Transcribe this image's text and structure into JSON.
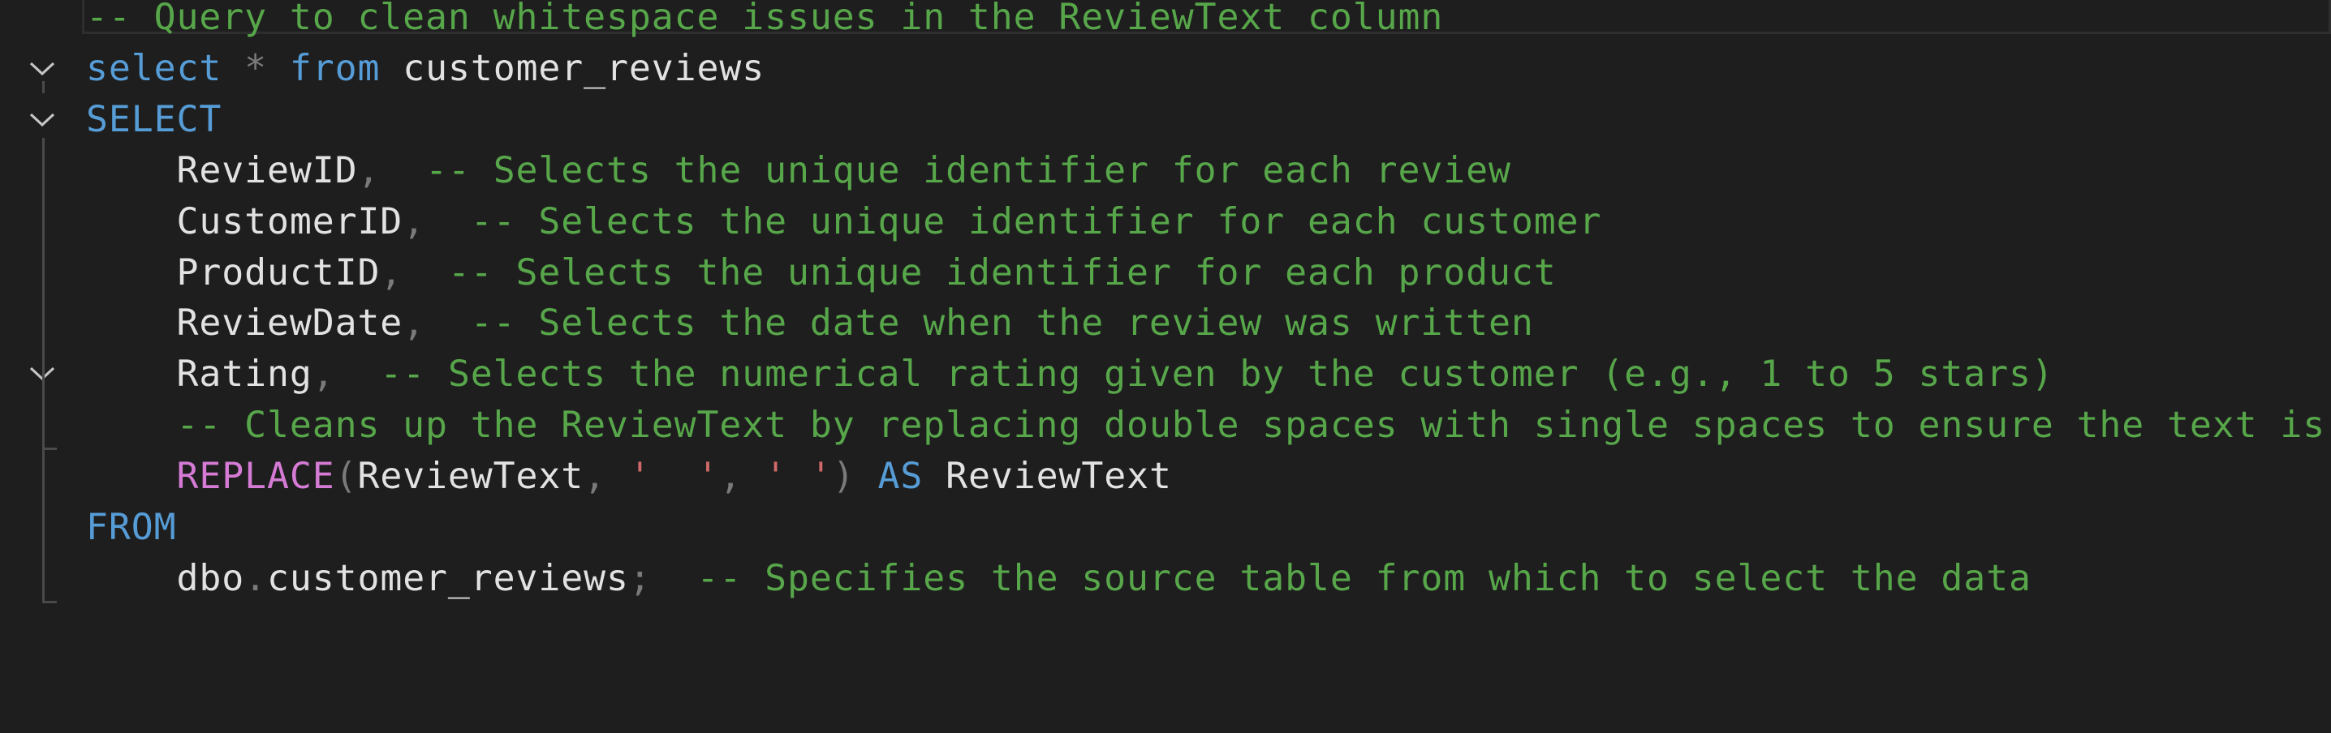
{
  "editor": {
    "language": "SQL",
    "fold_icon": "chevron-down-icon",
    "lines": [
      [
        {
          "t": "-- Query to clean whitespace issues in the ReviewText column",
          "c": "cm"
        }
      ],
      [
        {
          "t": "select",
          "c": "kw"
        },
        {
          "t": " ",
          "c": "id"
        },
        {
          "t": "*",
          "c": "pu"
        },
        {
          "t": " ",
          "c": "id"
        },
        {
          "t": "from",
          "c": "kw"
        },
        {
          "t": " customer_reviews",
          "c": "id"
        }
      ],
      [
        {
          "t": "SELECT",
          "c": "kw"
        }
      ],
      [
        {
          "t": "    ReviewID",
          "c": "id"
        },
        {
          "t": ",",
          "c": "pu"
        },
        {
          "t": "  ",
          "c": "id"
        },
        {
          "t": "-- Selects the unique identifier for each review",
          "c": "cm"
        }
      ],
      [
        {
          "t": "    CustomerID",
          "c": "id"
        },
        {
          "t": ",",
          "c": "pu"
        },
        {
          "t": "  ",
          "c": "id"
        },
        {
          "t": "-- Selects the unique identifier for each customer",
          "c": "cm"
        }
      ],
      [
        {
          "t": "    ProductID",
          "c": "id"
        },
        {
          "t": ",",
          "c": "pu"
        },
        {
          "t": "  ",
          "c": "id"
        },
        {
          "t": "-- Selects the unique identifier for each product",
          "c": "cm"
        }
      ],
      [
        {
          "t": "    ReviewDate",
          "c": "id"
        },
        {
          "t": ",",
          "c": "pu"
        },
        {
          "t": "  ",
          "c": "id"
        },
        {
          "t": "-- Selects the date when the review was written",
          "c": "cm"
        }
      ],
      [
        {
          "t": "    Rating",
          "c": "id"
        },
        {
          "t": ",",
          "c": "pu"
        },
        {
          "t": "  ",
          "c": "id"
        },
        {
          "t": "-- Selects the numerical rating given by the customer (e.g., 1 to 5 stars)",
          "c": "cm"
        }
      ],
      [
        {
          "t": "    ",
          "c": "id"
        },
        {
          "t": "-- Cleans up the ReviewText by replacing double spaces with single spaces to ensure the text is",
          "c": "cm"
        }
      ],
      [
        {
          "t": "    ",
          "c": "id"
        },
        {
          "t": "REPLACE",
          "c": "fn"
        },
        {
          "t": "(",
          "c": "pu"
        },
        {
          "t": "ReviewText",
          "c": "id"
        },
        {
          "t": ", ",
          "c": "pu"
        },
        {
          "t": "'  '",
          "c": "str"
        },
        {
          "t": ", ",
          "c": "pu"
        },
        {
          "t": "' '",
          "c": "str"
        },
        {
          "t": ") ",
          "c": "pu"
        },
        {
          "t": "AS",
          "c": "kw"
        },
        {
          "t": " ReviewText",
          "c": "id"
        }
      ],
      [
        {
          "t": "FROM",
          "c": "kw"
        }
      ],
      [
        {
          "t": "    dbo",
          "c": "id"
        },
        {
          "t": ".",
          "c": "pu"
        },
        {
          "t": "customer_reviews",
          "c": "id"
        },
        {
          "t": ";",
          "c": "pu"
        },
        {
          "t": "  ",
          "c": "id"
        },
        {
          "t": "-- Specifies the source table from which to select the data",
          "c": "cm"
        }
      ]
    ]
  }
}
